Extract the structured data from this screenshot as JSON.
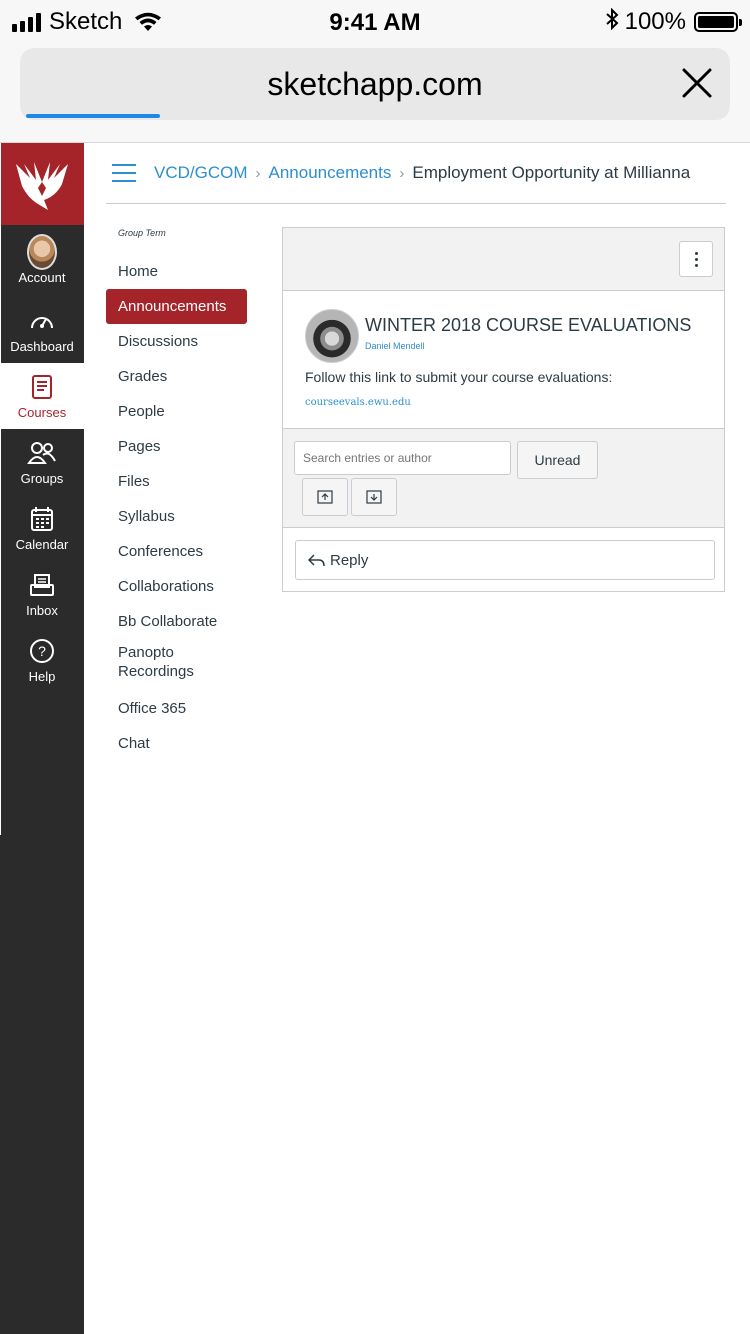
{
  "status_bar": {
    "carrier": "Sketch",
    "time": "9:41 AM",
    "battery": "100%"
  },
  "browser": {
    "url": "sketchapp.com",
    "load_progress": 0.2
  },
  "global_nav": {
    "items": [
      {
        "label": "Account",
        "icon": "avatar"
      },
      {
        "label": "Dashboard",
        "icon": "speedometer-icon"
      },
      {
        "label": "Courses",
        "icon": "book-icon",
        "active": true
      },
      {
        "label": "Groups",
        "icon": "groups-icon"
      },
      {
        "label": "Calendar",
        "icon": "calendar-icon"
      },
      {
        "label": "Inbox",
        "icon": "inbox-icon"
      },
      {
        "label": "Help",
        "icon": "help-icon"
      }
    ]
  },
  "breadcrumb": {
    "course": "VCD/GCOM",
    "section": "Announcements",
    "current": "Employment Opportunity at Millianna"
  },
  "course_nav": {
    "term": "Group Term",
    "items": [
      "Home",
      "Announcements",
      "Discussions",
      "Grades",
      "People",
      "Pages",
      "Files",
      "Syllabus",
      "Conferences",
      "Collaborations",
      "Bb Collaborate",
      "Panopto Recordings",
      "Office 365",
      "Chat"
    ],
    "active": "Announcements"
  },
  "announcement": {
    "title": "WINTER 2018 COURSE EVALUATIONS",
    "author": "Daniel Mendell",
    "body": "Follow this link to submit your course evaluations:",
    "link": "courseevals.ewu.edu"
  },
  "toolbar": {
    "search_placeholder": "Search entries or author",
    "unread_label": "Unread"
  },
  "reply": {
    "label": "Reply"
  },
  "colors": {
    "brand_red": "#a5242a",
    "link_blue": "#2d8fcf",
    "nav_dark": "#2b2b2b"
  }
}
